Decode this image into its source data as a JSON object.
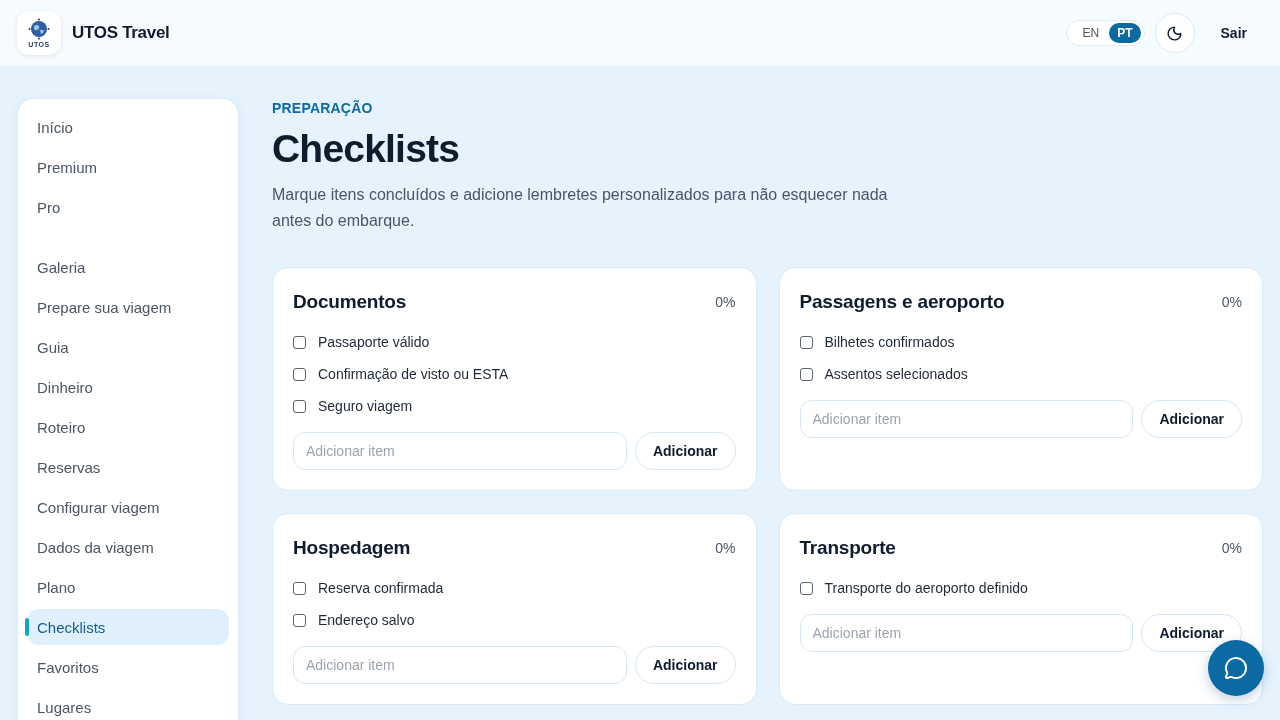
{
  "header": {
    "logo_text": "UTOS",
    "brand": "UTOS Travel",
    "languages": [
      {
        "label": "EN",
        "selected": false
      },
      {
        "label": "PT",
        "selected": true
      }
    ],
    "logout": "Sair"
  },
  "sidebar": {
    "sections": [
      {
        "items": [
          {
            "label": "Início",
            "selected": false
          },
          {
            "label": "Premium",
            "selected": false
          },
          {
            "label": "Pro",
            "selected": false
          }
        ]
      },
      {
        "items": [
          {
            "label": "Galeria",
            "selected": false
          },
          {
            "label": "Prepare sua viagem",
            "selected": false
          },
          {
            "label": "Guia",
            "selected": false
          },
          {
            "label": "Dinheiro",
            "selected": false
          },
          {
            "label": "Roteiro",
            "selected": false
          },
          {
            "label": "Reservas",
            "selected": false
          },
          {
            "label": "Configurar viagem",
            "selected": false
          },
          {
            "label": "Dados da viagem",
            "selected": false
          },
          {
            "label": "Plano",
            "selected": false
          },
          {
            "label": "Checklists",
            "selected": true
          },
          {
            "label": "Favoritos",
            "selected": false
          },
          {
            "label": "Lugares",
            "selected": false
          }
        ]
      }
    ]
  },
  "page": {
    "eyebrow": "PREPARAÇÃO",
    "title": "Checklists",
    "description": "Marque itens concluídos e adicione lembretes personalizados para não esquecer nada antes do embarque."
  },
  "checklists": [
    {
      "title": "Documentos",
      "progress": "0%",
      "items": [
        {
          "label": "Passaporte válido",
          "checked": false
        },
        {
          "label": "Confirmação de visto ou ESTA",
          "checked": false
        },
        {
          "label": "Seguro viagem",
          "checked": false
        }
      ],
      "input": {
        "placeholder": "Adicionar item"
      },
      "button": "Adicionar"
    },
    {
      "title": "Passagens e aeroporto",
      "progress": "0%",
      "items": [
        {
          "label": "Bilhetes confirmados",
          "checked": false
        },
        {
          "label": "Assentos selecionados",
          "checked": false
        }
      ],
      "input": {
        "placeholder": "Adicionar item"
      },
      "button": "Adicionar"
    },
    {
      "title": "Hospedagem",
      "progress": "0%",
      "items": [
        {
          "label": "Reserva confirmada",
          "checked": false
        },
        {
          "label": "Endereço salvo",
          "checked": false
        }
      ],
      "input": {
        "placeholder": "Adicionar item"
      },
      "button": "Adicionar"
    },
    {
      "title": "Transporte",
      "progress": "0%",
      "items": [
        {
          "label": "Transporte do aeroporto definido",
          "checked": false
        }
      ],
      "input": {
        "placeholder": "Adicionar item"
      },
      "button": "Adicionar"
    }
  ]
}
